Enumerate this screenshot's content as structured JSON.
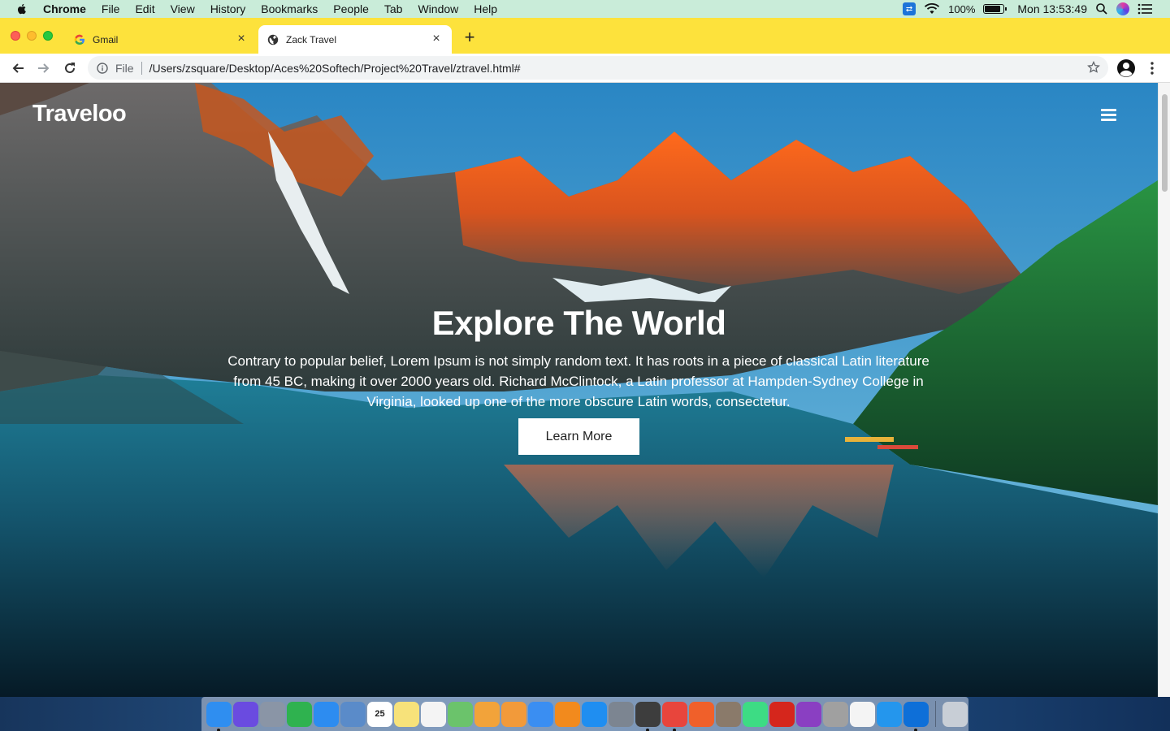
{
  "menubar": {
    "app_name": "Chrome",
    "menus": [
      "File",
      "Edit",
      "View",
      "History",
      "Bookmarks",
      "People",
      "Tab",
      "Window",
      "Help"
    ],
    "battery_text": "100%",
    "clock": "Mon 13:53:49"
  },
  "tabs": [
    {
      "title": "Gmail",
      "favicon": "google-g-icon",
      "active": false
    },
    {
      "title": "Zack Travel",
      "favicon": "globe-icon",
      "active": true
    }
  ],
  "toolbar": {
    "scheme_label": "File",
    "url": "/Users/zsquare/Desktop/Aces%20Softech/Project%20Travel/ztravel.html#"
  },
  "page": {
    "logo": "Traveloo",
    "hero_title": "Explore The World",
    "hero_text": "Contrary to popular belief, Lorem Ipsum is not simply random text. It has roots in a piece of classical Latin literature from 45 BC, making it over 2000 years old. Richard McClintock, a Latin professor at Hampden-Sydney College in Virginia, looked up one of the more obscure Latin words, consectetur.",
    "cta_label": "Learn More"
  },
  "dock": {
    "items": [
      {
        "name": "finder",
        "color": "#2f8ef0",
        "running": true
      },
      {
        "name": "siri",
        "color": "#6a4be0",
        "running": false
      },
      {
        "name": "launchpad",
        "color": "#8a95a6",
        "running": false
      },
      {
        "name": "numbers",
        "color": "#2fb24f",
        "running": false
      },
      {
        "name": "safari",
        "color": "#2d8cf0",
        "running": false
      },
      {
        "name": "preview",
        "color": "#5a8bc9",
        "running": false
      },
      {
        "name": "calendar",
        "color": "#ffffff",
        "running": false,
        "label": "25"
      },
      {
        "name": "notes",
        "color": "#f7e27a",
        "running": false
      },
      {
        "name": "reminders",
        "color": "#f4f4f4",
        "running": false
      },
      {
        "name": "maps",
        "color": "#6bc36b",
        "running": false
      },
      {
        "name": "photos",
        "color": "#f2a33a",
        "running": false
      },
      {
        "name": "pages",
        "color": "#f29a3a",
        "running": false
      },
      {
        "name": "keynote",
        "color": "#3a8ef2",
        "running": false
      },
      {
        "name": "books",
        "color": "#f28a1d",
        "running": false
      },
      {
        "name": "app-store",
        "color": "#1f8ef1",
        "running": false
      },
      {
        "name": "system-preferences",
        "color": "#7c8591",
        "running": false
      },
      {
        "name": "sublime-text",
        "color": "#3d3d3d",
        "running": true
      },
      {
        "name": "chrome",
        "color": "#e8453c",
        "running": true
      },
      {
        "name": "swift-playgrounds",
        "color": "#f0602a",
        "running": false
      },
      {
        "name": "archive",
        "color": "#8a7a6a",
        "running": false
      },
      {
        "name": "android-studio",
        "color": "#3ddc84",
        "running": false
      },
      {
        "name": "acrobat",
        "color": "#d5261c",
        "running": false
      },
      {
        "name": "github-desktop",
        "color": "#8a3fc2",
        "running": false
      },
      {
        "name": "utilities",
        "color": "#a0a0a0",
        "running": false
      },
      {
        "name": "textedit",
        "color": "#f4f4f4",
        "running": false
      },
      {
        "name": "docker",
        "color": "#2496ed",
        "running": false
      },
      {
        "name": "teamviewer",
        "color": "#0e6fd8",
        "running": true
      },
      {
        "name": "trash",
        "color": "#c8ced6",
        "running": false
      }
    ]
  }
}
